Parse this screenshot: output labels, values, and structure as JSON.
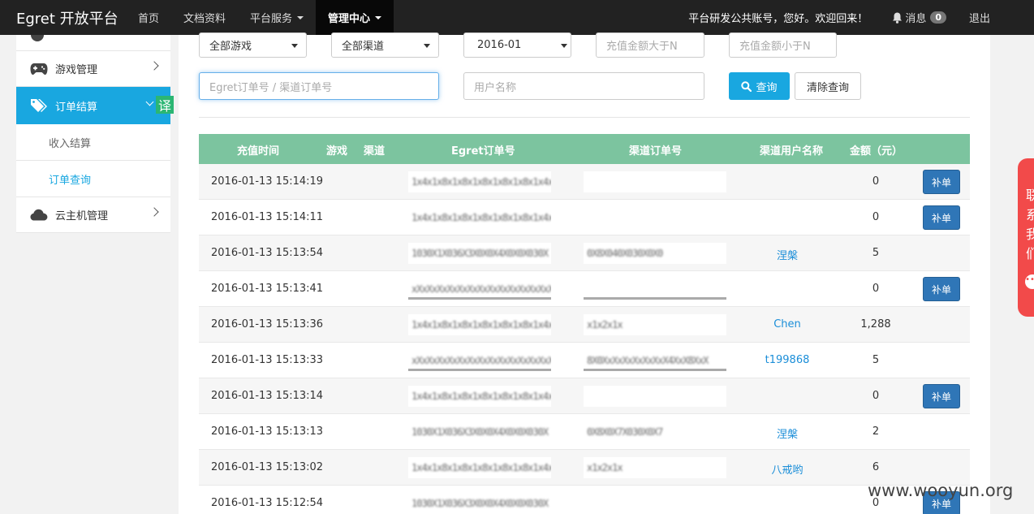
{
  "navbar": {
    "brand": "Egret 开放平台",
    "items": [
      {
        "label": "首页"
      },
      {
        "label": "文档资料"
      },
      {
        "label": "平台服务"
      },
      {
        "label": "管理中心"
      }
    ],
    "welcome": "平台研发公共账号，您好。欢迎回来！",
    "messages_label": "消息",
    "messages_count": "0",
    "logout": "退出"
  },
  "sidebar": {
    "items": [
      {
        "label": "游戏管理",
        "icon": "gamepad-icon"
      },
      {
        "label": "订单结算",
        "icon": "tags-icon"
      },
      {
        "label": "云主机管理",
        "icon": "cloud-icon"
      }
    ],
    "subitems": [
      {
        "label": "收入结算"
      },
      {
        "label": "订单查询"
      }
    ],
    "translate_badge": "译"
  },
  "filters": {
    "game_select": "全部游戏",
    "channel_select": "全部渠道",
    "month_select": "2016-01",
    "amount_min_placeholder": "充值金额大于N",
    "amount_max_placeholder": "充值金额小于N",
    "order_placeholder": "Egret订单号 / 渠道订单号",
    "username_placeholder": "用户名称",
    "search_label": "查询",
    "clear_label": "清除查询"
  },
  "table": {
    "headers": [
      "充值时间",
      "游戏",
      "渠道",
      "Egret订单号",
      "渠道订单号",
      "渠道用户名称",
      "金额（元）"
    ],
    "fix_label": "补单",
    "rows": [
      {
        "time": "2016-01-13 15:14:19",
        "egret": "1x4x1x8x1x8x1x8x1x8x1x8x1x4x1x8x",
        "channel": "",
        "user": "",
        "amount": "0",
        "fix": true
      },
      {
        "time": "2016-01-13 15:14:11",
        "egret": "1x4x1x8x1x8x1x8x1x8x1x8x1x4x1x8x",
        "channel": "",
        "user": "",
        "amount": "0",
        "fix": true
      },
      {
        "time": "2016-01-13 15:13:54",
        "egret": "1030X1X036X3X0X0X4X0X0X030X",
        "channel": "0X8X040X030X0X0",
        "user": "涅槃",
        "amount": "5",
        "fix": false
      },
      {
        "time": "2016-01-13 15:13:41",
        "egret": "xXxXxXxXxXxXxXxXxXxXxXxXxXxX",
        "channel": "",
        "user": "",
        "amount": "0",
        "fix": true
      },
      {
        "time": "2016-01-13 15:13:36",
        "egret": "1x4x1x8x1x8x1x8x1x8x1x8x1x4x1x8x",
        "channel": "x1x2x1x",
        "user": "Chen",
        "amount": "1,288",
        "fix": false
      },
      {
        "time": "2016-01-13 15:13:33",
        "egret": "xXxXxXxXxXxXxXxXxXxXxXxXxXxX",
        "channel": "8X0XxXxXxXxXxXxX4XxX8XxX",
        "user": "t199868",
        "amount": "5",
        "fix": false
      },
      {
        "time": "2016-01-13 15:13:14",
        "egret": "1x4x1x8x1x8x1x8x1x8x1x8x1x4x1x8x",
        "channel": "",
        "user": "",
        "amount": "0",
        "fix": true
      },
      {
        "time": "2016-01-13 15:13:13",
        "egret": "1030X1X036X3X0X0X4X0X0X030X",
        "channel": "0X8X0X7X030X0X7",
        "user": "涅槃",
        "amount": "2",
        "fix": false
      },
      {
        "time": "2016-01-13 15:13:02",
        "egret": "1x4x1x8x1x8x1x8x1x8x1x8x1x4x1x8x",
        "channel": "x1x2x1x",
        "user": "八戒哟",
        "amount": "6",
        "fix": false
      },
      {
        "time": "2016-01-13 15:12:54",
        "egret": "1030X1X036X3X0X0X4X0X0X030X",
        "channel": "",
        "user": "",
        "amount": "0",
        "fix": true
      }
    ]
  },
  "contact_tab": "联系我们",
  "watermark": "www.wooyun.org"
}
